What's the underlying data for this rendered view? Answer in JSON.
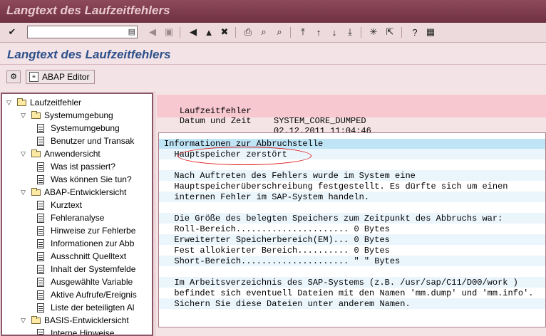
{
  "window": {
    "title": "Langtext des Laufzeitfehlers"
  },
  "toolbar": {
    "command_value": ""
  },
  "screen": {
    "title": "Langtext des Laufzeitfehlers"
  },
  "app_toolbar": {
    "abap_editor_label": "ABAP Editor"
  },
  "tree": {
    "items": [
      {
        "label": "Laufzeitfehler",
        "kind": "folder",
        "level": 0
      },
      {
        "label": "Systemumgebung",
        "kind": "folder",
        "level": 1
      },
      {
        "label": "Systemumgebung",
        "kind": "doc",
        "level": 2
      },
      {
        "label": "Benutzer und Transak",
        "kind": "doc",
        "level": 2
      },
      {
        "label": "Anwendersicht",
        "kind": "folder",
        "level": 1
      },
      {
        "label": "Was ist passiert?",
        "kind": "doc",
        "level": 2
      },
      {
        "label": "Was können Sie tun?",
        "kind": "doc",
        "level": 2
      },
      {
        "label": "ABAP-Entwicklersicht",
        "kind": "folder",
        "level": 1
      },
      {
        "label": "Kurztext",
        "kind": "doc",
        "level": 2
      },
      {
        "label": "Fehleranalyse",
        "kind": "doc",
        "level": 2
      },
      {
        "label": "Hinweise zur Fehlerbe",
        "kind": "doc",
        "level": 2
      },
      {
        "label": "Informationen zur Abb",
        "kind": "doc",
        "level": 2
      },
      {
        "label": "Ausschnitt Quelltext",
        "kind": "doc",
        "level": 2
      },
      {
        "label": "Inhalt der Systemfelde",
        "kind": "doc",
        "level": 2
      },
      {
        "label": "Ausgewählte Variable",
        "kind": "doc",
        "level": 2
      },
      {
        "label": "Aktive Aufrufe/Ereignis",
        "kind": "doc",
        "level": 2
      },
      {
        "label": "Liste der beteiligten Al",
        "kind": "doc",
        "level": 2
      },
      {
        "label": "BASIS-Entwicklersicht",
        "kind": "folder",
        "level": 1
      },
      {
        "label": "Interne Hinweise",
        "kind": "doc",
        "level": 2
      }
    ]
  },
  "header": {
    "error_label": "Laufzeitfehler",
    "error_value": "SYSTEM_CORE_DUMPED",
    "datetime_label": "Datum und Zeit",
    "datetime_value": "02.12.2011 11:04:46"
  },
  "content": {
    "section_title": "Informationen zur Abbruchstelle",
    "lines": [
      "  Hauptspeicher zerstört",
      "",
      "  Nach Auftreten des Fehlers wurde im System eine",
      "  Hauptspeicherüberschreibung festgestellt. Es dürfte sich um einen",
      "  internen Fehler im SAP-System handeln.",
      "",
      "  Die Größe des belegten Speichers zum Zeitpunkt des Abbruchs war:",
      "  Roll-Bereich...................... 0 Bytes",
      "  Erweiterter Speicherbereich(EM)... 0 Bytes",
      "  Fest allokierter Bereich.......... 0 Bytes",
      "  Short-Bereich..................... \" \" Bytes",
      "",
      "  Im Arbeitsverzeichnis des SAP-Systems (z.B. /usr/sap/C11/D00/work )",
      "  befindet sich eventuell Dateien mit den Namen 'mm.dump' und 'mm.info'.",
      "  Sichern Sie diese Dateien unter anderem Namen."
    ]
  }
}
